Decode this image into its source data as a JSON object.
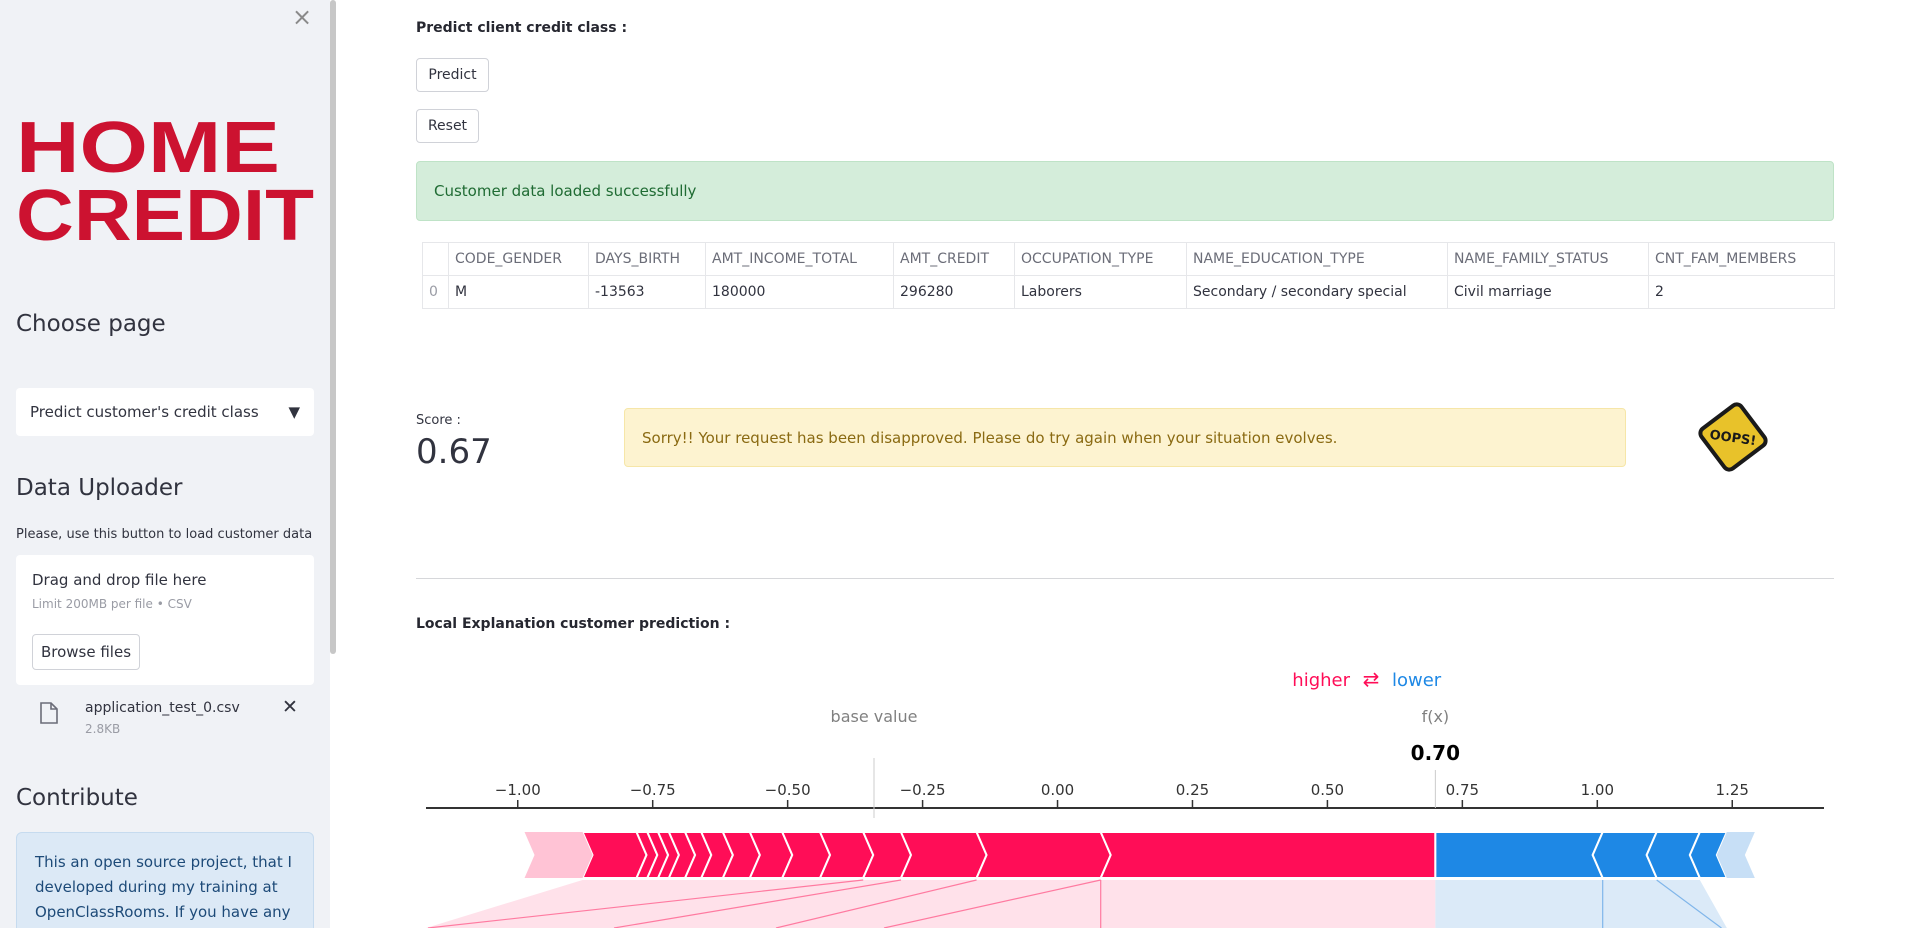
{
  "sidebar": {
    "logo_line1": "HOME",
    "logo_line2": "CREDIT",
    "choose_page_heading": "Choose page",
    "page_select_value": "Predict customer's credit class",
    "data_uploader_heading": "Data Uploader",
    "uploader_help": "Please, use this button to load customer data",
    "dropzone_title": "Drag and drop file here",
    "dropzone_limit": "Limit 200MB per file • CSV",
    "browse_label": "Browse files",
    "file_name": "application_test_0.csv",
    "file_size": "2.8KB",
    "contribute_heading": "Contribute",
    "contribute_text": "This an open source project, that I developed during my training at OpenClassRooms. If you have any"
  },
  "main": {
    "predict_heading": "Predict client credit class :",
    "predict_button": "Predict",
    "reset_button": "Reset",
    "success_message": "Customer data loaded successfully",
    "table": {
      "columns": [
        "",
        "CODE_GENDER",
        "DAYS_BIRTH",
        "AMT_INCOME_TOTAL",
        "AMT_CREDIT",
        "OCCUPATION_TYPE",
        "NAME_EDUCATION_TYPE",
        "NAME_FAMILY_STATUS",
        "CNT_FAM_MEMBERS"
      ],
      "rows": [
        [
          "0",
          "M",
          "-13563",
          "180000",
          "296280",
          "Laborers",
          "Secondary / secondary special",
          "Civil marriage",
          "2"
        ]
      ]
    },
    "score_label": "Score :",
    "score_value": "0.67",
    "warning_message": "Sorry!! Your request has been disapproved. Please do try again when your situation evolves.",
    "oops_text": "OOPS!",
    "explanation_heading": "Local Explanation customer prediction :"
  },
  "chart_data": {
    "type": "force",
    "legend_higher": "higher",
    "legend_lower": "lower",
    "arrows_glyph": "⇄",
    "base_value_label": "base value",
    "fx_label": "f(x)",
    "fx_value_text": "0.70",
    "base_value": -0.34,
    "fx_value": 0.7,
    "xlim": [
      -1.17,
      1.42
    ],
    "ticks": [
      -1.0,
      -0.75,
      -0.5,
      -0.25,
      0.0,
      0.25,
      0.5,
      0.75,
      1.0,
      1.25
    ],
    "tick_labels": [
      "−1.00",
      "−0.75",
      "−0.50",
      "−0.25",
      "0.00",
      "0.25",
      "0.50",
      "0.75",
      "1.00",
      "1.25"
    ],
    "higher_color": "#ff0d57",
    "lower_color": "#1e88e5",
    "higher_segments": [
      [
        -0.88,
        -0.78
      ],
      [
        -0.78,
        -0.76
      ],
      [
        -0.76,
        -0.74
      ],
      [
        -0.74,
        -0.72
      ],
      [
        -0.72,
        -0.69
      ],
      [
        -0.69,
        -0.66
      ],
      [
        -0.66,
        -0.62
      ],
      [
        -0.62,
        -0.57
      ],
      [
        -0.57,
        -0.51
      ],
      [
        -0.51,
        -0.44
      ],
      [
        -0.44,
        -0.36
      ],
      [
        -0.36,
        -0.29
      ],
      [
        -0.29,
        -0.15
      ],
      [
        -0.15,
        0.08
      ],
      [
        0.08,
        0.7
      ]
    ],
    "lower_segments": [
      [
        0.7,
        1.01
      ],
      [
        1.01,
        1.11
      ],
      [
        1.11,
        1.19
      ],
      [
        1.19,
        1.24
      ]
    ]
  }
}
